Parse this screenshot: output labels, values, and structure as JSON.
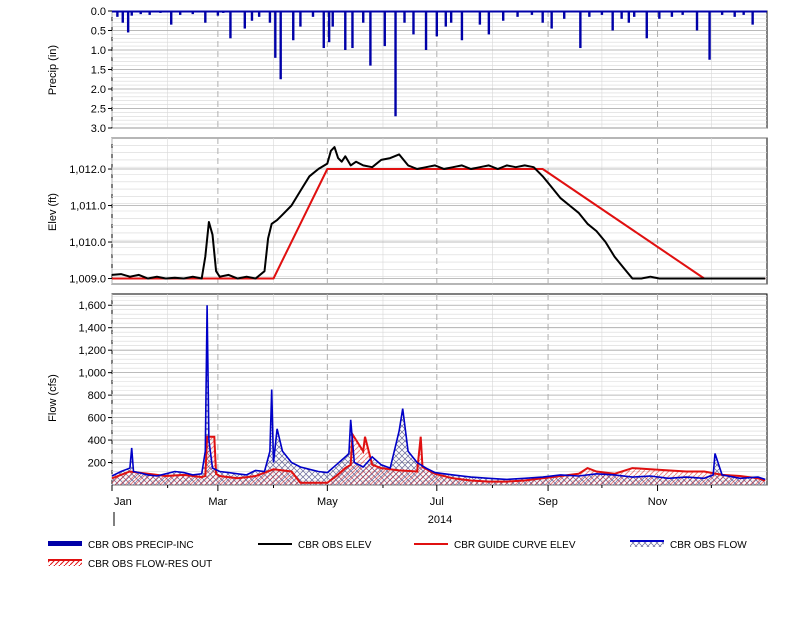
{
  "colors": {
    "precip": "#0000a8",
    "elev": "#000000",
    "guide": "#e01010",
    "flow": "#0000c8",
    "flow_res_out": "#e01010",
    "grid": "#c0c0c0",
    "grid_major": "#a0a0a0"
  },
  "x_axis": {
    "year": "2014",
    "month_labels": [
      "Jan",
      "Mar",
      "May",
      "Jul",
      "Sep",
      "Nov"
    ]
  },
  "chart_data": [
    {
      "type": "bar",
      "ylabel": "Precip (in)",
      "ylim": [
        0.0,
        3.0
      ],
      "inverted": true,
      "ytick_labels": [
        "0.0",
        "0.5",
        "1.0",
        "1.5",
        "2.0",
        "2.5",
        "3.0"
      ],
      "ytick_values": [
        0.0,
        0.5,
        1.0,
        1.5,
        2.0,
        2.5,
        3.0
      ],
      "series": [
        {
          "name": "CBR OBS PRECIP-INC",
          "x": [
            3,
            6,
            9,
            11,
            16,
            21,
            27,
            33,
            38,
            45,
            52,
            59,
            62,
            66,
            74,
            78,
            82,
            88,
            91,
            94,
            101,
            105,
            112,
            118,
            121,
            123,
            130,
            134,
            140,
            144,
            152,
            158,
            163,
            168,
            175,
            181,
            186,
            189,
            195,
            205,
            210,
            218,
            226,
            234,
            240,
            245,
            252,
            261,
            266,
            273,
            279,
            284,
            288,
            291,
            298,
            305,
            312,
            318,
            326,
            333,
            340,
            347,
            352,
            357
          ],
          "values": [
            0.15,
            0.3,
            0.55,
            0.12,
            0.08,
            0.1,
            0.05,
            0.35,
            0.1,
            0.08,
            0.3,
            0.12,
            0.05,
            0.7,
            0.45,
            0.25,
            0.15,
            0.3,
            1.2,
            1.75,
            0.75,
            0.4,
            0.15,
            0.95,
            0.8,
            0.4,
            1.0,
            0.95,
            0.3,
            1.4,
            0.9,
            2.7,
            0.3,
            0.6,
            1.0,
            0.65,
            0.4,
            0.3,
            0.75,
            0.35,
            0.6,
            0.25,
            0.15,
            0.1,
            0.3,
            0.45,
            0.2,
            0.95,
            0.15,
            0.1,
            0.5,
            0.2,
            0.3,
            0.15,
            0.7,
            0.2,
            0.15,
            0.1,
            0.5,
            1.25,
            0.1,
            0.15,
            0.1,
            0.35
          ]
        }
      ]
    },
    {
      "type": "line",
      "ylabel": "Elev (ft)",
      "ylim": [
        1008.85,
        1012.85
      ],
      "ytick_labels": [
        "1,009.0",
        "1,010.0",
        "1,011.0",
        "1,012.0"
      ],
      "ytick_values": [
        1009.0,
        1010.0,
        1011.0,
        1012.0
      ],
      "series": [
        {
          "name": "CBR OBS ELEV",
          "x": [
            0,
            5,
            10,
            15,
            20,
            25,
            30,
            35,
            40,
            45,
            50,
            52,
            54,
            56,
            58,
            60,
            65,
            70,
            75,
            80,
            85,
            87,
            89,
            92,
            95,
            100,
            105,
            110,
            115,
            120,
            122,
            124,
            126,
            128,
            130,
            133,
            136,
            140,
            145,
            150,
            155,
            160,
            165,
            170,
            175,
            180,
            185,
            190,
            195,
            200,
            205,
            210,
            215,
            220,
            225,
            230,
            235,
            240,
            245,
            250,
            255,
            260,
            265,
            270,
            275,
            280,
            285,
            290,
            295,
            300,
            305,
            310,
            315,
            320,
            325,
            330,
            335,
            340,
            345,
            350,
            355,
            360,
            364
          ],
          "values": [
            1009.1,
            1009.12,
            1009.05,
            1009.1,
            1009.0,
            1009.05,
            1009.0,
            1009.02,
            1009.0,
            1009.05,
            1009.0,
            1009.6,
            1010.55,
            1010.2,
            1009.2,
            1009.05,
            1009.1,
            1009.0,
            1009.05,
            1009.0,
            1009.2,
            1010.1,
            1010.5,
            1010.6,
            1010.75,
            1011.0,
            1011.4,
            1011.8,
            1012.0,
            1012.15,
            1012.5,
            1012.6,
            1012.3,
            1012.2,
            1012.35,
            1012.1,
            1012.2,
            1012.1,
            1012.05,
            1012.25,
            1012.3,
            1012.4,
            1012.1,
            1012.0,
            1012.05,
            1012.1,
            1012.0,
            1012.05,
            1012.1,
            1012.0,
            1012.05,
            1012.1,
            1012.0,
            1012.1,
            1012.05,
            1012.1,
            1012.05,
            1011.8,
            1011.5,
            1011.2,
            1011.0,
            1010.8,
            1010.5,
            1010.3,
            1010.0,
            1009.6,
            1009.3,
            1009.0,
            1009.0,
            1009.05,
            1009.0,
            1009.0,
            1009.0,
            1009.0,
            1009.0,
            1009.0,
            1009.0,
            1009.0,
            1009.0,
            1009.0,
            1009.0,
            1009.0,
            1009.0
          ]
        },
        {
          "name": "CBR GUIDE CURVE ELEV",
          "x": [
            0,
            30,
            60,
            90,
            120,
            150,
            180,
            210,
            240,
            270,
            300,
            330,
            364
          ],
          "values": [
            1009.0,
            1009.0,
            1009.0,
            1009.0,
            1012.0,
            1012.0,
            1012.0,
            1012.0,
            1012.0,
            1011.0,
            1010.0,
            1009.0,
            1009.0
          ]
        }
      ]
    },
    {
      "type": "line",
      "ylabel": "Flow (cfs)",
      "ylim": [
        0,
        1700
      ],
      "ytick_labels": [
        "200",
        "400",
        "600",
        "800",
        "1,000",
        "1,200",
        "1,400",
        "1,600"
      ],
      "ytick_values": [
        200,
        400,
        600,
        800,
        1000,
        1200,
        1400,
        1600
      ],
      "series": [
        {
          "name": "CBR OBS FLOW",
          "x": [
            0,
            5,
            10,
            11,
            12,
            15,
            20,
            25,
            30,
            35,
            40,
            45,
            50,
            52,
            53,
            54,
            56,
            60,
            65,
            70,
            75,
            80,
            85,
            88,
            89,
            90,
            92,
            95,
            100,
            105,
            110,
            115,
            120,
            125,
            130,
            132,
            133,
            135,
            140,
            145,
            150,
            155,
            160,
            162,
            165,
            170,
            175,
            180,
            190,
            200,
            210,
            220,
            230,
            240,
            250,
            260,
            270,
            280,
            290,
            300,
            310,
            320,
            330,
            335,
            336,
            340,
            350,
            360,
            364
          ],
          "values": [
            80,
            120,
            150,
            330,
            120,
            110,
            90,
            80,
            100,
            120,
            110,
            90,
            100,
            300,
            1600,
            400,
            150,
            120,
            110,
            100,
            90,
            130,
            120,
            300,
            850,
            200,
            500,
            300,
            200,
            160,
            140,
            120,
            110,
            180,
            250,
            280,
            580,
            200,
            160,
            250,
            180,
            150,
            480,
            680,
            300,
            200,
            150,
            110,
            90,
            70,
            60,
            50,
            60,
            70,
            90,
            80,
            100,
            90,
            70,
            80,
            60,
            70,
            60,
            90,
            280,
            90,
            60,
            70,
            50
          ]
        },
        {
          "name": "CBR OBS FLOW-RES OUT",
          "x": [
            0,
            10,
            20,
            30,
            40,
            50,
            52,
            53,
            57,
            58,
            60,
            70,
            80,
            90,
            100,
            105,
            110,
            115,
            120,
            125,
            130,
            133,
            134,
            140,
            141,
            145,
            150,
            160,
            170,
            172,
            173,
            180,
            190,
            200,
            210,
            220,
            230,
            240,
            250,
            260,
            265,
            270,
            280,
            290,
            300,
            310,
            320,
            330,
            340,
            350,
            360,
            364
          ],
          "values": [
            60,
            120,
            100,
            80,
            90,
            70,
            80,
            430,
            430,
            100,
            80,
            60,
            80,
            140,
            120,
            20,
            20,
            20,
            20,
            80,
            150,
            180,
            450,
            300,
            430,
            180,
            150,
            130,
            120,
            430,
            160,
            100,
            60,
            40,
            30,
            30,
            40,
            60,
            80,
            100,
            150,
            120,
            100,
            150,
            140,
            130,
            120,
            120,
            90,
            80,
            60,
            40
          ]
        }
      ]
    }
  ],
  "legend": [
    {
      "label": "CBR OBS PRECIP-INC",
      "style": "bar"
    },
    {
      "label": "CBR OBS ELEV",
      "style": "black-line"
    },
    {
      "label": "CBR GUIDE CURVE ELEV",
      "style": "red-line"
    },
    {
      "label": "CBR OBS FLOW",
      "style": "blue-hatch"
    },
    {
      "label": "CBR OBS FLOW-RES OUT",
      "style": "red-hatch"
    }
  ]
}
